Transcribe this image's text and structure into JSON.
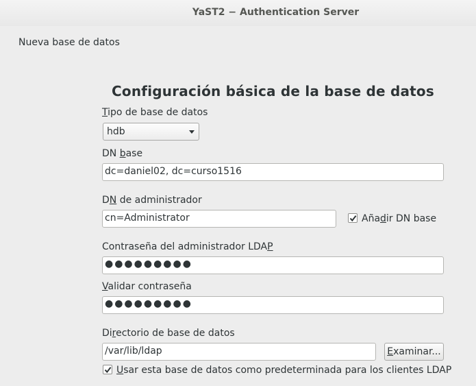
{
  "window": {
    "title": "YaST2 − Authentication Server"
  },
  "page": {
    "heading": "Nueva base de datos",
    "dialog_title": "Configuración básica de la base de datos"
  },
  "db_type": {
    "label_prefix": "",
    "label_mnemonic": "T",
    "label_rest": "ipo de base de datos",
    "value": "hdb"
  },
  "base_dn": {
    "label_prefix": "DN ",
    "label_mnemonic": "b",
    "label_rest": "ase",
    "value": "dc=daniel02, dc=curso1516"
  },
  "admin_dn": {
    "label_prefix": "D",
    "label_mnemonic": "N",
    "label_rest": " de administrador",
    "value": "cn=Administrator",
    "append_label_prefix": "Aña",
    "append_label_mnemonic": "d",
    "append_label_rest": "ir DN base",
    "append_checked": true
  },
  "admin_password": {
    "label_prefix": "Contraseña del administrador LDA",
    "label_mnemonic": "P",
    "label_rest": "",
    "value": "●●●●●●●●●"
  },
  "validate_password": {
    "label_prefix": "",
    "label_mnemonic": "V",
    "label_rest": "alidar contraseña",
    "value": "●●●●●●●●●"
  },
  "db_directory": {
    "label_prefix": "Di",
    "label_mnemonic": "r",
    "label_rest": "ectorio de base de datos",
    "value": "/var/lib/ldap",
    "browse_prefix": "",
    "browse_mnemonic": "E",
    "browse_rest": "xaminar..."
  },
  "default_db": {
    "label_prefix": "",
    "label_mnemonic": "U",
    "label_rest": "sar esta base de datos como predeterminada para los clientes LDAP",
    "checked": true
  }
}
